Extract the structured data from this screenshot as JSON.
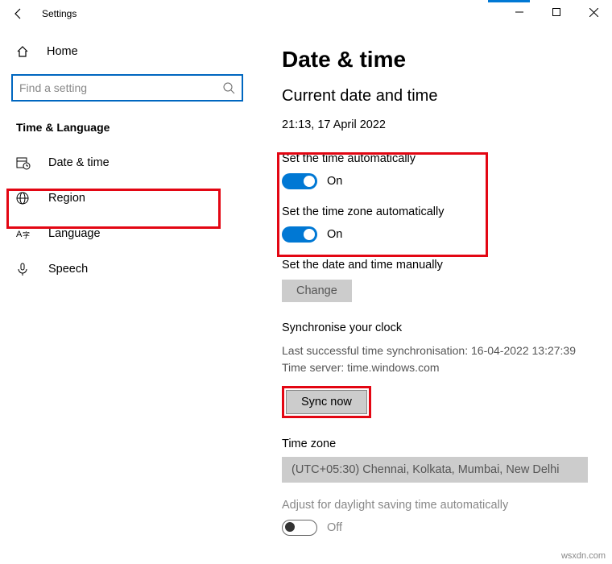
{
  "window": {
    "title": "Settings"
  },
  "sidebar": {
    "home": "Home",
    "search_placeholder": "Find a setting",
    "category": "Time & Language",
    "items": [
      {
        "label": "Date & time"
      },
      {
        "label": "Region"
      },
      {
        "label": "Language"
      },
      {
        "label": "Speech"
      }
    ]
  },
  "main": {
    "heading": "Date & time",
    "subheading": "Current date and time",
    "now": "21:13, 17 April 2022",
    "auto_time_label": "Set the time automatically",
    "auto_time_state": "On",
    "auto_tz_label": "Set the time zone automatically",
    "auto_tz_state": "On",
    "manual_label": "Set the date and time manually",
    "change_btn": "Change",
    "sync_heading": "Synchronise your clock",
    "sync_last": "Last successful time synchronisation: 16-04-2022 13:27:39",
    "sync_server": "Time server: time.windows.com",
    "sync_btn": "Sync now",
    "tz_heading": "Time zone",
    "tz_value": "(UTC+05:30) Chennai, Kolkata, Mumbai, New Delhi",
    "dst_label": "Adjust for daylight saving time automatically",
    "dst_state": "Off"
  },
  "watermark": "wsxdn.com"
}
